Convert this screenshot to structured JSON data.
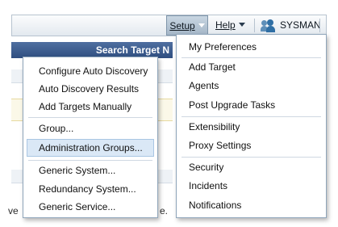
{
  "menubar": {
    "setup_label": "Setup",
    "help_label": "Help",
    "user_label": "SYSMAN"
  },
  "background": {
    "banner_text": "Search Target N",
    "left_fragment": "ve",
    "right_fragment": "e."
  },
  "submenu": {
    "items": [
      {
        "label": "Configure Auto Discovery"
      },
      {
        "label": "Auto Discovery Results"
      },
      {
        "label": "Add Targets Manually"
      },
      {
        "label": "Group..."
      },
      {
        "label": "Administration Groups..."
      },
      {
        "label": "Generic System..."
      },
      {
        "label": "Redundancy System..."
      },
      {
        "label": "Generic Service..."
      }
    ],
    "selected_item": "Administration Groups..."
  },
  "setup_menu": {
    "items": [
      {
        "label": "My Preferences"
      },
      {
        "label": "Add Target"
      },
      {
        "label": "Agents"
      },
      {
        "label": "Post Upgrade Tasks"
      },
      {
        "label": "Extensibility"
      },
      {
        "label": "Proxy Settings"
      },
      {
        "label": "Security"
      },
      {
        "label": "Incidents"
      },
      {
        "label": "Notifications"
      }
    ]
  },
  "colors": {
    "highlight": "#dae8f6",
    "banner": "#3a5a8c",
    "setup_active": "#b3c4d4"
  }
}
